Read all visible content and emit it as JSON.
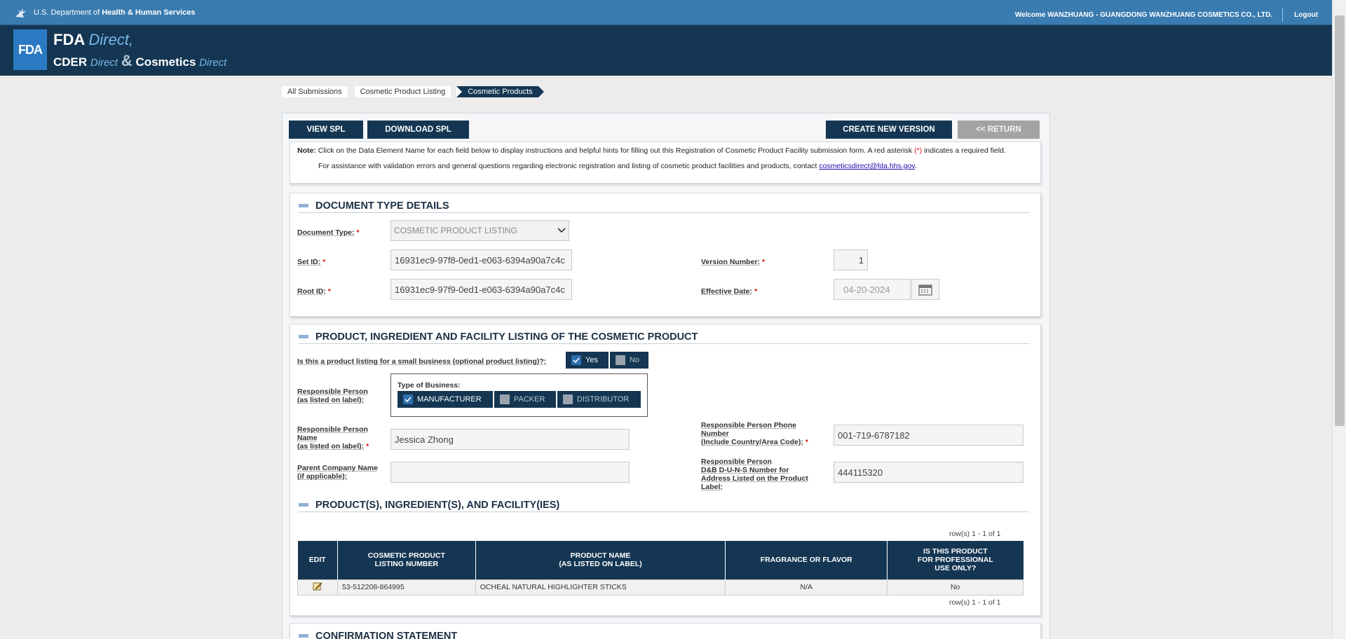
{
  "hhs": {
    "agency": "U.S. Department of",
    "agency_bold": "Health & Human Services",
    "welcome": "Welcome WANZHUANG - GUANGDONG WANZHUANG COSMETICS CO., LTD.",
    "logout": "Logout"
  },
  "brand": {
    "logo": "FDA",
    "line1_bold": "FDA",
    "line1_italic": "Direct,",
    "line2_a": "CDER",
    "line2_a_italic": "Direct",
    "amp": "&",
    "line2_b": "Cosmetics",
    "line2_b_italic": "Direct"
  },
  "breadcrumb": {
    "items": [
      "All Submissions",
      "Cosmetic Product Listing",
      "Cosmetic Products"
    ]
  },
  "toolbar": {
    "view_spl": "VIEW SPL",
    "download_spl": "DOWNLOAD SPL",
    "create_new_version": "CREATE NEW VERSION",
    "return": "<< RETURN"
  },
  "note": {
    "label": "Note:",
    "text": "Click on the Data Element Name for each field below to display instructions and helpful hints for filling out this Registration of Cosmetic Product Facility submission form. A red asterisk",
    "asterisk": "(*)",
    "text2": "indicates a required field.",
    "assist": "For assistance with validation errors and general questions regarding electronic registration and listing of cosmetic product facilities and products, contact",
    "email": "cosmeticsdirect@fda.hhs.gov",
    "period": "."
  },
  "document_type": {
    "title": "DOCUMENT TYPE DETAILS",
    "doc_type_label": "Document Type:",
    "doc_type_value": "COSMETIC PRODUCT LISTING",
    "set_id_label": "Set ID:",
    "set_id_value": "16931ec9-97f8-0ed1-e063-6394a90a7c4c",
    "root_id_label": "Root ID:",
    "root_id_value": "16931ec9-97f9-0ed1-e063-6394a90a7c4c",
    "version_label": "Version Number:",
    "version_value": "1",
    "effective_label": "Effective Date:",
    "effective_value": "04-20-2024"
  },
  "listing": {
    "title": "PRODUCT, INGREDIENT AND FACILITY LISTING OF THE COSMETIC PRODUCT",
    "small_business_label": "Is this a product listing for a small business (optional product listing)?:",
    "yes": "Yes",
    "no": "No",
    "small_business_selected": "Yes",
    "resp_person_label_1": "Responsible Person",
    "resp_person_label_2": "(as listed on label):",
    "type_of_business": "Type of Business:",
    "manufacturer": "MANUFACTURER",
    "packer": "PACKER",
    "distributor": "DISTRIBUTOR",
    "business_selected": "MANUFACTURER",
    "name_label_1": "Responsible Person",
    "name_label_2": "Name",
    "name_label_3": "(as listed on label):",
    "name_value": "Jessica   Zhong",
    "parent_label_1": "Parent Company Name",
    "parent_label_2": "(if applicable):",
    "parent_value": "",
    "phone_label_1": "Responsible Person Phone",
    "phone_label_2": "Number",
    "phone_label_3": "(Include Country/Area Code):",
    "phone_value": "001-719-6787182",
    "duns_label_1": "Responsible Person",
    "duns_label_2": "D&B D-U-N-S Number for",
    "duns_label_3": "Address Listed on the Product",
    "duns_label_4": "Label:",
    "duns_value": "444115320"
  },
  "products": {
    "title": "PRODUCT(S), INGREDIENT(S), AND FACILITY(IES)",
    "rowcount": "row(s) 1 - 1 of 1",
    "headers": {
      "edit": "EDIT",
      "listing_1": "COSMETIC PRODUCT",
      "listing_2": "LISTING NUMBER",
      "name_1": "PRODUCT NAME",
      "name_2": "(AS LISTED ON LABEL)",
      "fragrance": "FRAGRANCE OR FLAVOR",
      "pro_1": "IS THIS PRODUCT",
      "pro_2": "FOR PROFESSIONAL",
      "pro_3": "USE ONLY?"
    },
    "rows": [
      {
        "listing_number": "53-512208-864995",
        "product_name": "OCHEAL NATURAL HIGHLIGHTER STICKS",
        "fragrance": "N/A",
        "professional": "No"
      }
    ]
  },
  "confirmation": {
    "title": "CONFIRMATION STATEMENT"
  },
  "colors": {
    "navy": "#143652",
    "hhs_blue": "#3a7bb0",
    "required": "#dd1111"
  }
}
